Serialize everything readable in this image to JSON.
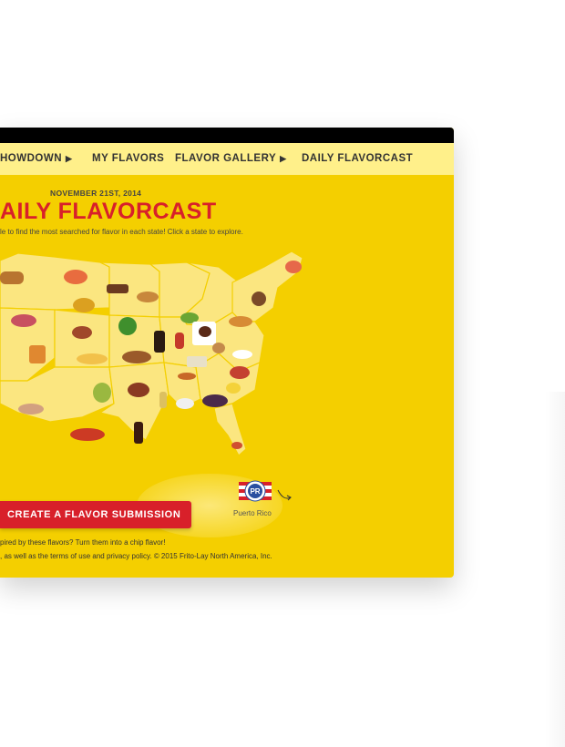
{
  "nav": {
    "items": [
      {
        "label": "HOWDOWN",
        "caret": "▶"
      },
      {
        "label": "MY FLAVORS",
        "caret": ""
      },
      {
        "label": "FLAVOR GALLERY",
        "caret": "▶"
      },
      {
        "label": "DAILY FLAVORCAST",
        "caret": ""
      }
    ]
  },
  "header": {
    "date": "NOVEMBER 21ST, 2014",
    "title": "AILY FLAVORCAST",
    "subtitle": "le to find the most searched for flavor in each state! Click a state to explore."
  },
  "map": {
    "region_label": "Puerto Rico",
    "pr_badge_text": "PR"
  },
  "cta": {
    "label": "CREATE A FLAVOR SUBMISSION"
  },
  "footer": {
    "inspire": "pired by these flavors? Turn them into a chip flavor!",
    "legal": ", as well as the terms of use and privacy policy. © 2015 Frito-Lay North America, Inc."
  },
  "colors": {
    "background": "#f4cf00",
    "nav_bar": "#fff08a",
    "accent_red": "#d8202a",
    "map_fill": "#fbe680",
    "state_border": "#f4cf00"
  }
}
